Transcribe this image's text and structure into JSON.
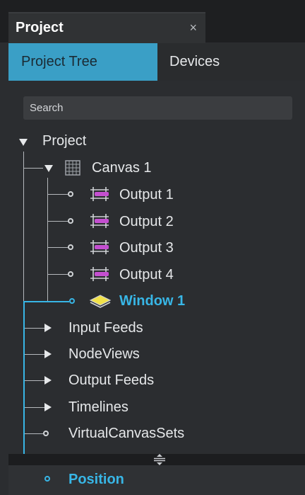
{
  "panel": {
    "title": "Project",
    "close_glyph": "×"
  },
  "tabs": [
    {
      "label": "Project Tree",
      "active": true
    },
    {
      "label": "Devices",
      "active": false
    }
  ],
  "search": {
    "placeholder": "Search",
    "value": ""
  },
  "tree": {
    "project": "Project",
    "canvas": "Canvas 1",
    "outputs": [
      "Output 1",
      "Output 2",
      "Output 3",
      "Output 4"
    ],
    "window": "Window 1",
    "folders": [
      "Input Feeds",
      "NodeViews",
      "Output Feeds",
      "Timelines"
    ],
    "virtual_canvas_sets": "VirtualCanvasSets"
  },
  "bottom": {
    "position": "Position"
  },
  "colors": {
    "accent": "#38b6e6",
    "active_tab": "#3a9fc6",
    "output_icon": "#c44fd0",
    "window_icon": "#f2e24a"
  },
  "icons": {
    "expanded": "triangle-down-icon",
    "collapsed": "triangle-right-icon",
    "leaf": "circle-icon",
    "canvas": "grid-icon",
    "output": "output-icon",
    "window": "window-layers-icon",
    "grip": "resize-grip-icon"
  }
}
